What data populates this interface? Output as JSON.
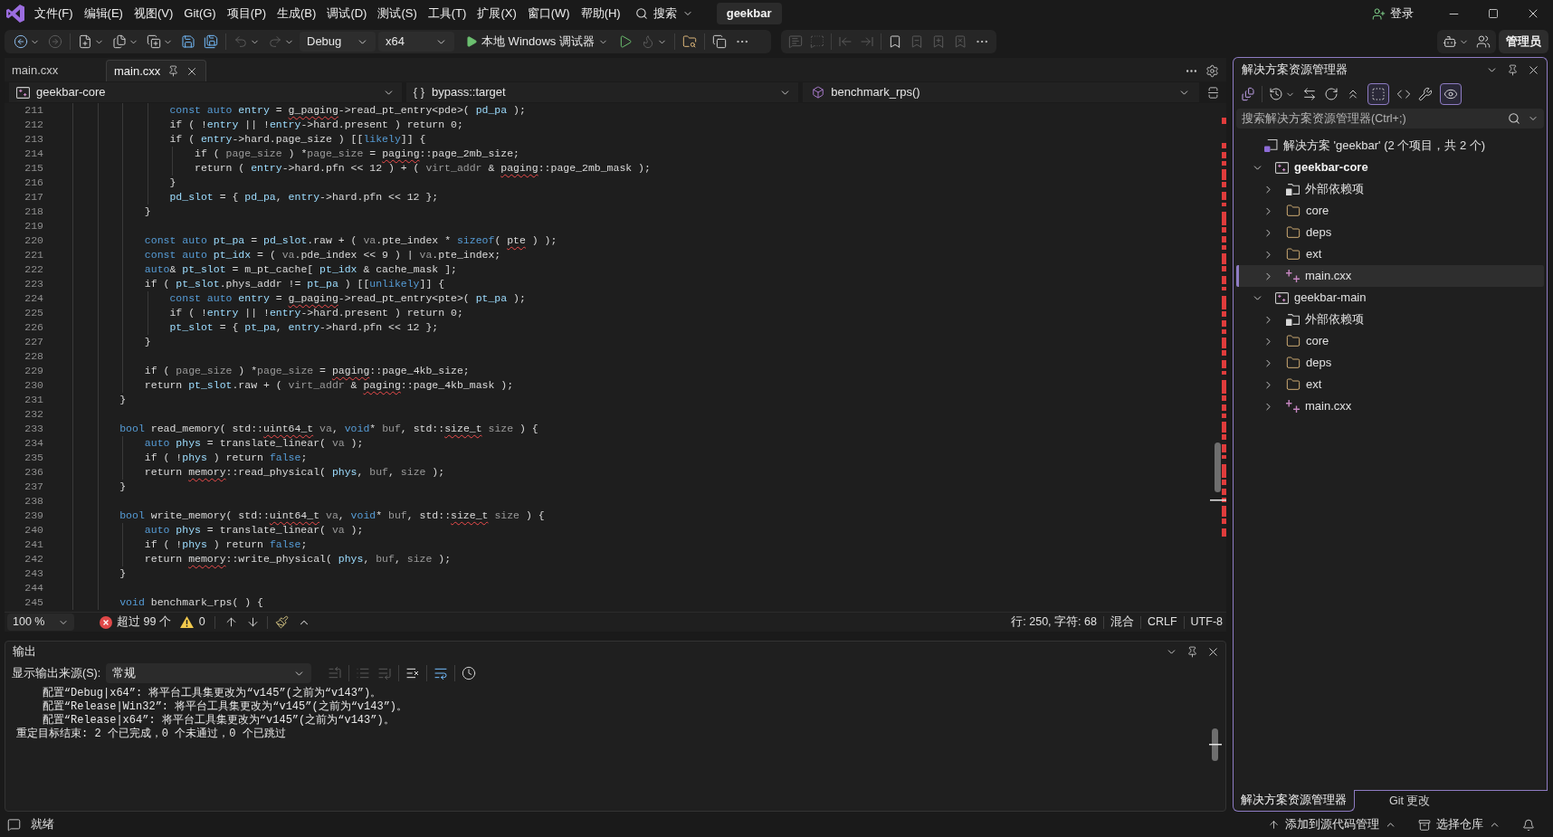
{
  "title_bar": {
    "menu": [
      "文件(F)",
      "编辑(E)",
      "视图(V)",
      "Git(G)",
      "项目(P)",
      "生成(B)",
      "调试(D)",
      "测试(S)",
      "工具(T)",
      "扩展(X)",
      "窗口(W)",
      "帮助(H)"
    ],
    "search": "搜索",
    "solution_name": "geekbar",
    "sign_in": "登录"
  },
  "toolbar": {
    "items": [
      {
        "kind": "back",
        "disabled": false,
        "dropdown": true
      },
      {
        "kind": "forward",
        "disabled": true,
        "dropdown": false
      },
      {
        "kind": "separator"
      },
      {
        "kind": "new-project",
        "disabled": false,
        "dropdown": true
      },
      {
        "kind": "open-file",
        "disabled": false,
        "dropdown": true
      },
      {
        "kind": "add-item",
        "disabled": false,
        "dropdown": true
      },
      {
        "kind": "save",
        "disabled": false,
        "dropdown": false
      },
      {
        "kind": "save-all",
        "disabled": false,
        "dropdown": false
      },
      {
        "kind": "separator"
      },
      {
        "kind": "undo",
        "disabled": true,
        "dropdown": true
      },
      {
        "kind": "redo",
        "disabled": true,
        "dropdown": true
      },
      {
        "kind": "combo",
        "label": "Debug"
      },
      {
        "kind": "combo",
        "label": "x64"
      },
      {
        "kind": "start",
        "label": "本地 Windows 调试器",
        "dropdown": true
      },
      {
        "kind": "start-without-debugging",
        "disabled": false,
        "dropdown": false
      },
      {
        "kind": "hot-reload",
        "disabled": true,
        "dropdown": true
      },
      {
        "kind": "separator"
      },
      {
        "kind": "find-in-files",
        "disabled": false,
        "dropdown": false
      },
      {
        "kind": "separator"
      },
      {
        "kind": "windows",
        "disabled": false,
        "dropdown": false
      },
      {
        "kind": "more",
        "disabled": false,
        "dropdown": false
      }
    ],
    "text_editor_items": [
      {
        "kind": "comment",
        "disabled": true,
        "dropdown": false
      },
      {
        "kind": "uncomment",
        "disabled": true,
        "dropdown": false
      },
      {
        "kind": "separator"
      },
      {
        "kind": "outdent",
        "disabled": true,
        "dropdown": false
      },
      {
        "kind": "indent",
        "disabled": true,
        "dropdown": false
      },
      {
        "kind": "separator"
      },
      {
        "kind": "bookmark",
        "disabled": false,
        "dropdown": false
      },
      {
        "kind": "previous-bookmark",
        "disabled": true,
        "dropdown": false
      },
      {
        "kind": "next-bookmark",
        "disabled": true,
        "dropdown": false
      },
      {
        "kind": "clear-bookmarks",
        "disabled": true,
        "dropdown": false
      },
      {
        "kind": "more",
        "disabled": false,
        "dropdown": false
      }
    ],
    "right_items": [
      {
        "kind": "copilot",
        "disabled": false,
        "dropdown": true
      },
      {
        "kind": "live-share",
        "disabled": false,
        "dropdown": false
      }
    ],
    "account": "管理员"
  },
  "editor": {
    "tabs": [
      {
        "label": "main.cxx",
        "selected": false
      },
      {
        "label": "main.cxx",
        "selected": true
      }
    ],
    "navigation": {
      "project": "geekbar-core",
      "scope_icon": "{ }",
      "scope": "bypass::target",
      "member": "benchmark_rps()"
    },
    "lines": [
      {
        "number": "211",
        "tokens": [
          {
            "text": "                const auto ",
            "kind": "keyword"
          },
          {
            "text": "entry",
            "kind": "variable"
          },
          {
            "text": " = ",
            "kind": "plain"
          },
          {
            "text": "g_paging",
            "kind": "error"
          },
          {
            "text": "->read_pt_entry<pde>( ",
            "kind": "plain"
          },
          {
            "text": "pd_pa",
            "kind": "variable"
          },
          {
            "text": " );",
            "kind": "plain"
          }
        ]
      },
      {
        "number": "212",
        "tokens": [
          {
            "text": "                if ( !",
            "kind": "plain"
          },
          {
            "text": "entry",
            "kind": "variable"
          },
          {
            "text": " || !",
            "kind": "plain"
          },
          {
            "text": "entry",
            "kind": "variable"
          },
          {
            "text": "->hard.present ) return 0;",
            "kind": "plain"
          }
        ]
      },
      {
        "number": "213",
        "tokens": [
          {
            "text": "                if ( ",
            "kind": "plain"
          },
          {
            "text": "entry",
            "kind": "variable"
          },
          {
            "text": "->hard.page_size ) [[",
            "kind": "plain"
          },
          {
            "text": "likely",
            "kind": "keyword"
          },
          {
            "text": "]] {",
            "kind": "plain"
          }
        ]
      },
      {
        "number": "214",
        "tokens": [
          {
            "text": "                    if ( ",
            "kind": "plain"
          },
          {
            "text": "page_size",
            "kind": "parameter"
          },
          {
            "text": " ) *",
            "kind": "plain"
          },
          {
            "text": "page_size",
            "kind": "parameter"
          },
          {
            "text": " = ",
            "kind": "plain"
          },
          {
            "text": "paging",
            "kind": "error"
          },
          {
            "text": "::page_2mb_size;",
            "kind": "plain"
          }
        ]
      },
      {
        "number": "215",
        "tokens": [
          {
            "text": "                    return ( ",
            "kind": "plain"
          },
          {
            "text": "entry",
            "kind": "variable"
          },
          {
            "text": "->hard.pfn << 12 ) + ( ",
            "kind": "plain"
          },
          {
            "text": "virt_addr",
            "kind": "parameter"
          },
          {
            "text": " & ",
            "kind": "plain"
          },
          {
            "text": "paging",
            "kind": "error"
          },
          {
            "text": "::page_2mb_mask );",
            "kind": "plain"
          }
        ]
      },
      {
        "number": "216",
        "tokens": [
          {
            "text": "                }",
            "kind": "plain"
          }
        ]
      },
      {
        "number": "217",
        "tokens": [
          {
            "text": "                pd_slot",
            "kind": "variable"
          },
          {
            "text": " = { ",
            "kind": "plain"
          },
          {
            "text": "pd_pa",
            "kind": "variable"
          },
          {
            "text": ", ",
            "kind": "plain"
          },
          {
            "text": "entry",
            "kind": "variable"
          },
          {
            "text": "->hard.pfn << 12 };",
            "kind": "plain"
          }
        ]
      },
      {
        "number": "218",
        "tokens": [
          {
            "text": "            }",
            "kind": "plain"
          }
        ]
      },
      {
        "number": "219"
      },
      {
        "number": "220",
        "tokens": [
          {
            "text": "            const auto ",
            "kind": "keyword"
          },
          {
            "text": "pt_pa",
            "kind": "variable"
          },
          {
            "text": " = ",
            "kind": "plain"
          },
          {
            "text": "pd_slot",
            "kind": "variable"
          },
          {
            "text": ".raw + ( ",
            "kind": "plain"
          },
          {
            "text": "va",
            "kind": "parameter"
          },
          {
            "text": ".pte_index * ",
            "kind": "plain"
          },
          {
            "text": "sizeof",
            "kind": "keyword"
          },
          {
            "text": "( ",
            "kind": "plain"
          },
          {
            "text": "pte",
            "kind": "error"
          },
          {
            "text": " ) );",
            "kind": "plain"
          }
        ]
      },
      {
        "number": "221",
        "tokens": [
          {
            "text": "            const auto ",
            "kind": "keyword"
          },
          {
            "text": "pt_idx",
            "kind": "variable"
          },
          {
            "text": " = ( ",
            "kind": "plain"
          },
          {
            "text": "va",
            "kind": "parameter"
          },
          {
            "text": ".pde_index << 9 ) | ",
            "kind": "plain"
          },
          {
            "text": "va",
            "kind": "parameter"
          },
          {
            "text": ".pte_index;",
            "kind": "plain"
          }
        ]
      },
      {
        "number": "222",
        "tokens": [
          {
            "text": "            auto",
            "kind": "keyword"
          },
          {
            "text": "& ",
            "kind": "plain"
          },
          {
            "text": "pt_slot",
            "kind": "variable"
          },
          {
            "text": " = m_pt_cache[ ",
            "kind": "plain"
          },
          {
            "text": "pt_idx",
            "kind": "variable"
          },
          {
            "text": " & cache_mask ];",
            "kind": "plain"
          }
        ]
      },
      {
        "number": "223",
        "tokens": [
          {
            "text": "            if ( ",
            "kind": "plain"
          },
          {
            "text": "pt_slot",
            "kind": "variable"
          },
          {
            "text": ".phys_addr != ",
            "kind": "plain"
          },
          {
            "text": "pt_pa",
            "kind": "variable"
          },
          {
            "text": " ) [[",
            "kind": "plain"
          },
          {
            "text": "unlikely",
            "kind": "keyword"
          },
          {
            "text": "]] {",
            "kind": "plain"
          }
        ]
      },
      {
        "number": "224",
        "tokens": [
          {
            "text": "                const auto ",
            "kind": "keyword"
          },
          {
            "text": "entry",
            "kind": "variable"
          },
          {
            "text": " = ",
            "kind": "plain"
          },
          {
            "text": "g_paging",
            "kind": "error"
          },
          {
            "text": "->read_pt_entry<pte>( ",
            "kind": "plain"
          },
          {
            "text": "pt_pa",
            "kind": "variable"
          },
          {
            "text": " );",
            "kind": "plain"
          }
        ]
      },
      {
        "number": "225",
        "tokens": [
          {
            "text": "                if ( !",
            "kind": "plain"
          },
          {
            "text": "entry",
            "kind": "variable"
          },
          {
            "text": " || !",
            "kind": "plain"
          },
          {
            "text": "entry",
            "kind": "variable"
          },
          {
            "text": "->hard.present ) return 0;",
            "kind": "plain"
          }
        ]
      },
      {
        "number": "226",
        "tokens": [
          {
            "text": "                pt_slot",
            "kind": "variable"
          },
          {
            "text": " = { ",
            "kind": "plain"
          },
          {
            "text": "pt_pa",
            "kind": "variable"
          },
          {
            "text": ", ",
            "kind": "plain"
          },
          {
            "text": "entry",
            "kind": "variable"
          },
          {
            "text": "->hard.pfn << 12 };",
            "kind": "plain"
          }
        ]
      },
      {
        "number": "227",
        "tokens": [
          {
            "text": "            }",
            "kind": "plain"
          }
        ]
      },
      {
        "number": "228"
      },
      {
        "number": "229",
        "tokens": [
          {
            "text": "            if ( ",
            "kind": "plain"
          },
          {
            "text": "page_size",
            "kind": "parameter"
          },
          {
            "text": " ) *",
            "kind": "plain"
          },
          {
            "text": "page_size",
            "kind": "parameter"
          },
          {
            "text": " = ",
            "kind": "plain"
          },
          {
            "text": "paging",
            "kind": "error"
          },
          {
            "text": "::page_4kb_size;",
            "kind": "plain"
          }
        ]
      },
      {
        "number": "230",
        "tokens": [
          {
            "text": "            return ",
            "kind": "plain"
          },
          {
            "text": "pt_slot",
            "kind": "variable"
          },
          {
            "text": ".raw + ( ",
            "kind": "plain"
          },
          {
            "text": "virt_addr",
            "kind": "parameter"
          },
          {
            "text": " & ",
            "kind": "plain"
          },
          {
            "text": "paging",
            "kind": "error"
          },
          {
            "text": "::page_4kb_mask );",
            "kind": "plain"
          }
        ]
      },
      {
        "number": "231",
        "tokens": [
          {
            "text": "        }",
            "kind": "plain"
          }
        ]
      },
      {
        "number": "232"
      },
      {
        "number": "233",
        "tokens": [
          {
            "text": "        bool ",
            "kind": "keyword"
          },
          {
            "text": "read_memory( std::",
            "kind": "plain"
          },
          {
            "text": "uint64_t",
            "kind": "error"
          },
          {
            "text": " va",
            "kind": "parameter"
          },
          {
            "text": ", ",
            "kind": "plain"
          },
          {
            "text": "void",
            "kind": "keyword"
          },
          {
            "text": "* ",
            "kind": "plain"
          },
          {
            "text": "buf",
            "kind": "parameter"
          },
          {
            "text": ", std::",
            "kind": "plain"
          },
          {
            "text": "size_t",
            "kind": "error"
          },
          {
            "text": " size",
            "kind": "parameter"
          },
          {
            "text": " ) {",
            "kind": "plain"
          }
        ]
      },
      {
        "number": "234",
        "tokens": [
          {
            "text": "            auto ",
            "kind": "keyword"
          },
          {
            "text": "phys",
            "kind": "variable"
          },
          {
            "text": " = translate_linear( ",
            "kind": "plain"
          },
          {
            "text": "va",
            "kind": "parameter"
          },
          {
            "text": " );",
            "kind": "plain"
          }
        ]
      },
      {
        "number": "235",
        "tokens": [
          {
            "text": "            if ( !",
            "kind": "plain"
          },
          {
            "text": "phys",
            "kind": "variable"
          },
          {
            "text": " ) return ",
            "kind": "plain"
          },
          {
            "text": "false",
            "kind": "keyword"
          },
          {
            "text": ";",
            "kind": "plain"
          }
        ]
      },
      {
        "number": "236",
        "tokens": [
          {
            "text": "            return ",
            "kind": "plain"
          },
          {
            "text": "memory",
            "kind": "error"
          },
          {
            "text": "::read_physical( ",
            "kind": "plain"
          },
          {
            "text": "phys",
            "kind": "variable"
          },
          {
            "text": ", ",
            "kind": "plain"
          },
          {
            "text": "buf",
            "kind": "parameter"
          },
          {
            "text": ", ",
            "kind": "plain"
          },
          {
            "text": "size",
            "kind": "parameter"
          },
          {
            "text": " );",
            "kind": "plain"
          }
        ]
      },
      {
        "number": "237",
        "tokens": [
          {
            "text": "        }",
            "kind": "plain"
          }
        ]
      },
      {
        "number": "238"
      },
      {
        "number": "239",
        "tokens": [
          {
            "text": "        bool ",
            "kind": "keyword"
          },
          {
            "text": "write_memory( std::",
            "kind": "plain"
          },
          {
            "text": "uint64_t",
            "kind": "error"
          },
          {
            "text": " va",
            "kind": "parameter"
          },
          {
            "text": ", ",
            "kind": "plain"
          },
          {
            "text": "void",
            "kind": "keyword"
          },
          {
            "text": "* ",
            "kind": "plain"
          },
          {
            "text": "buf",
            "kind": "parameter"
          },
          {
            "text": ", std::",
            "kind": "plain"
          },
          {
            "text": "size_t",
            "kind": "error"
          },
          {
            "text": " size",
            "kind": "parameter"
          },
          {
            "text": " ) {",
            "kind": "plain"
          }
        ]
      },
      {
        "number": "240",
        "tokens": [
          {
            "text": "            auto ",
            "kind": "keyword"
          },
          {
            "text": "phys",
            "kind": "variable"
          },
          {
            "text": " = translate_linear( ",
            "kind": "plain"
          },
          {
            "text": "va",
            "kind": "parameter"
          },
          {
            "text": " );",
            "kind": "plain"
          }
        ]
      },
      {
        "number": "241",
        "tokens": [
          {
            "text": "            if ( !",
            "kind": "plain"
          },
          {
            "text": "phys",
            "kind": "variable"
          },
          {
            "text": " ) return ",
            "kind": "plain"
          },
          {
            "text": "false",
            "kind": "keyword"
          },
          {
            "text": ";",
            "kind": "plain"
          }
        ]
      },
      {
        "number": "242",
        "tokens": [
          {
            "text": "            return ",
            "kind": "plain"
          },
          {
            "text": "memory",
            "kind": "error"
          },
          {
            "text": "::write_physical( ",
            "kind": "plain"
          },
          {
            "text": "phys",
            "kind": "variable"
          },
          {
            "text": ", ",
            "kind": "plain"
          },
          {
            "text": "buf",
            "kind": "parameter"
          },
          {
            "text": ", ",
            "kind": "plain"
          },
          {
            "text": "size",
            "kind": "parameter"
          },
          {
            "text": " );",
            "kind": "plain"
          }
        ]
      },
      {
        "number": "243",
        "tokens": [
          {
            "text": "        }",
            "kind": "plain"
          }
        ]
      },
      {
        "number": "244"
      },
      {
        "number": "245",
        "tokens": [
          {
            "text": "        void ",
            "kind": "keyword"
          },
          {
            "text": "benchmark_rps( ) {",
            "kind": "plain"
          }
        ]
      }
    ],
    "status": {
      "zoom": "100 %",
      "errors": "超过 99 个",
      "warnings": "0",
      "position": "行: 250, 字符: 68",
      "indicator": "混合",
      "line_ending": "CRLF",
      "encoding": "UTF-8"
    }
  },
  "output": {
    "title": "输出",
    "source_label": "显示输出来源(S):",
    "source": "常规",
    "toolbar": [
      {
        "kind": "previous-message",
        "disabled": true,
        "dropdown": false
      },
      {
        "kind": "separator"
      },
      {
        "kind": "next-message",
        "disabled": true,
        "dropdown": false
      },
      {
        "kind": "last-message",
        "disabled": true,
        "dropdown": false
      },
      {
        "kind": "separator"
      },
      {
        "kind": "clear-all",
        "disabled": false,
        "dropdown": false
      },
      {
        "kind": "separator"
      },
      {
        "kind": "word-wrap",
        "disabled": false,
        "dropdown": false
      },
      {
        "kind": "separator"
      },
      {
        "kind": "timestamps",
        "disabled": false,
        "dropdown": false
      }
    ],
    "lines": [
      "    配置“Debug|x64”: 将平台工具集更改为“v145”(之前为“v143”)。",
      "    配置“Release|Win32”: 将平台工具集更改为“v145”(之前为“v143”)。",
      "    配置“Release|x64”: 将平台工具集更改为“v145”(之前为“v143”)。",
      "重定目标结束: 2 个已完成，0 个未通过，0 个已跳过"
    ]
  },
  "solution_explorer": {
    "title": "解决方案资源管理器",
    "toolbar": [
      {
        "kind": "switch-views",
        "on": false,
        "dropdown": false
      },
      {
        "kind": "separator"
      },
      {
        "kind": "pending-changes",
        "on": false,
        "dropdown": true
      },
      {
        "kind": "sync",
        "on": false,
        "dropdown": false
      },
      {
        "kind": "refresh",
        "on": false,
        "dropdown": false
      },
      {
        "kind": "collapse-all",
        "on": false,
        "dropdown": false
      },
      {
        "kind": "show-all-files",
        "on": true,
        "dropdown": false
      },
      {
        "kind": "code",
        "on": false,
        "dropdown": false
      },
      {
        "kind": "properties",
        "on": false,
        "dropdown": false
      },
      {
        "kind": "preview",
        "on": true,
        "dropdown": false
      }
    ],
    "search_placeholder": "搜索解决方案资源管理器(Ctrl+;)",
    "tree": [
      {
        "kind": "solution",
        "label": "解决方案 'geekbar' (2 个项目，共 2 个)",
        "selected": false,
        "children": [
          {
            "kind": "project",
            "label": "geekbar-core",
            "expanded": true,
            "startup": true,
            "selected": false,
            "children": [
              {
                "kind": "references",
                "label": "外部依赖项",
                "expanded": false,
                "selected": false
              },
              {
                "kind": "folder",
                "label": "core",
                "expanded": false,
                "selected": false
              },
              {
                "kind": "folder",
                "label": "deps",
                "expanded": false,
                "selected": false
              },
              {
                "kind": "folder",
                "label": "ext",
                "expanded": false,
                "selected": false
              },
              {
                "kind": "file",
                "label": "main.cxx",
                "expanded": false,
                "selected": true
              }
            ]
          },
          {
            "kind": "project",
            "label": "geekbar-main",
            "expanded": true,
            "startup": false,
            "selected": false,
            "children": [
              {
                "kind": "references",
                "label": "外部依赖项",
                "expanded": false,
                "selected": false
              },
              {
                "kind": "folder",
                "label": "core",
                "expanded": false,
                "selected": false
              },
              {
                "kind": "folder",
                "label": "deps",
                "expanded": false,
                "selected": false
              },
              {
                "kind": "folder",
                "label": "ext",
                "expanded": false,
                "selected": false
              },
              {
                "kind": "file",
                "label": "main.cxx",
                "expanded": false,
                "selected": false
              }
            ]
          }
        ]
      }
    ],
    "tabs": [
      {
        "label": "解决方案资源管理器",
        "selected": true
      },
      {
        "label": "Git 更改",
        "selected": false
      }
    ]
  },
  "status_bar": {
    "message": "就绪",
    "source_control": "添加到源代码管理",
    "repository": "选择仓库"
  }
}
